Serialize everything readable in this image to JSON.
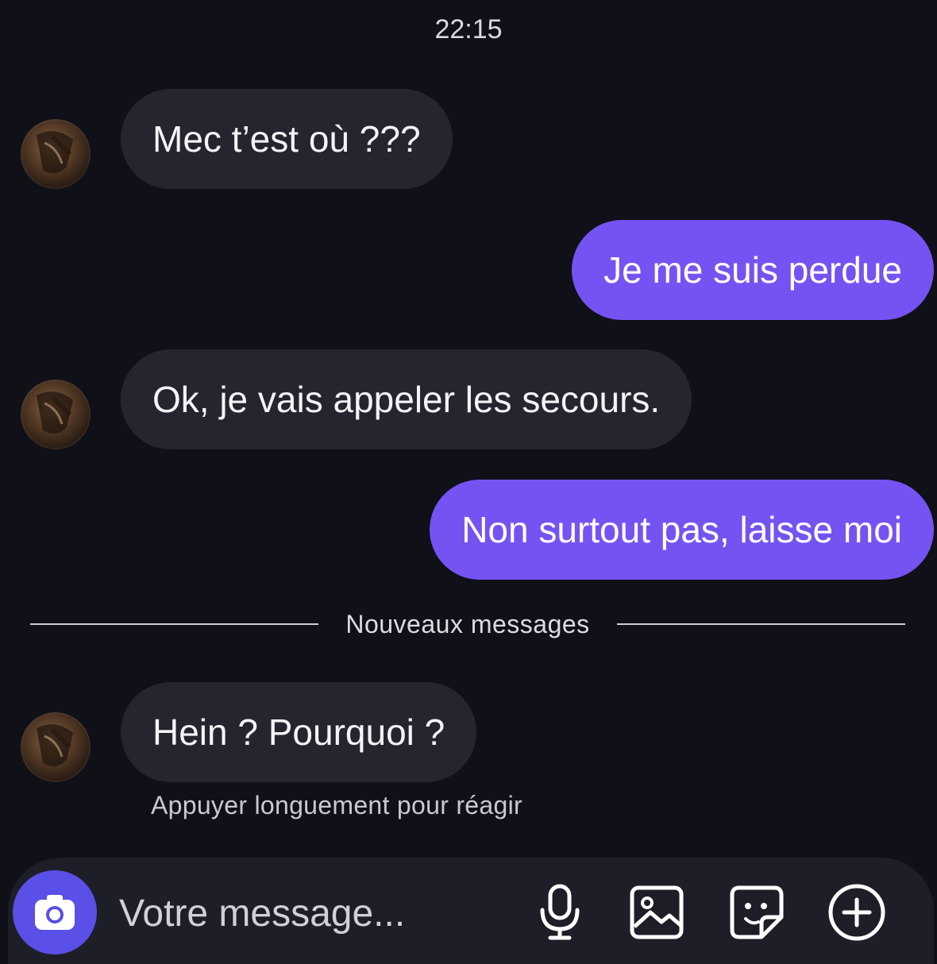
{
  "header": {
    "time": "22:15"
  },
  "messages": [
    {
      "direction": "incoming",
      "text": "Mec t’est où ???"
    },
    {
      "direction": "outgoing",
      "text": "Je me suis perdue"
    },
    {
      "direction": "incoming",
      "text": "Ok, je vais appeler les secours."
    },
    {
      "direction": "outgoing",
      "text": "Non surtout pas, laisse moi"
    },
    {
      "direction": "incoming",
      "text": "Hein ? Pourquoi ?"
    }
  ],
  "divider": {
    "label": "Nouveaux messages"
  },
  "hint": {
    "text": "Appuyer longuement pour réagir"
  },
  "composer": {
    "placeholder": "Votre message...",
    "icons": [
      "camera-icon",
      "microphone-icon",
      "image-icon",
      "sticker-icon",
      "add-icon"
    ]
  },
  "colors": {
    "background": "#0f1018",
    "incoming_bubble": "#24252f",
    "outgoing_bubble": "#7553f2",
    "camera_button": "#5a4fe6"
  }
}
